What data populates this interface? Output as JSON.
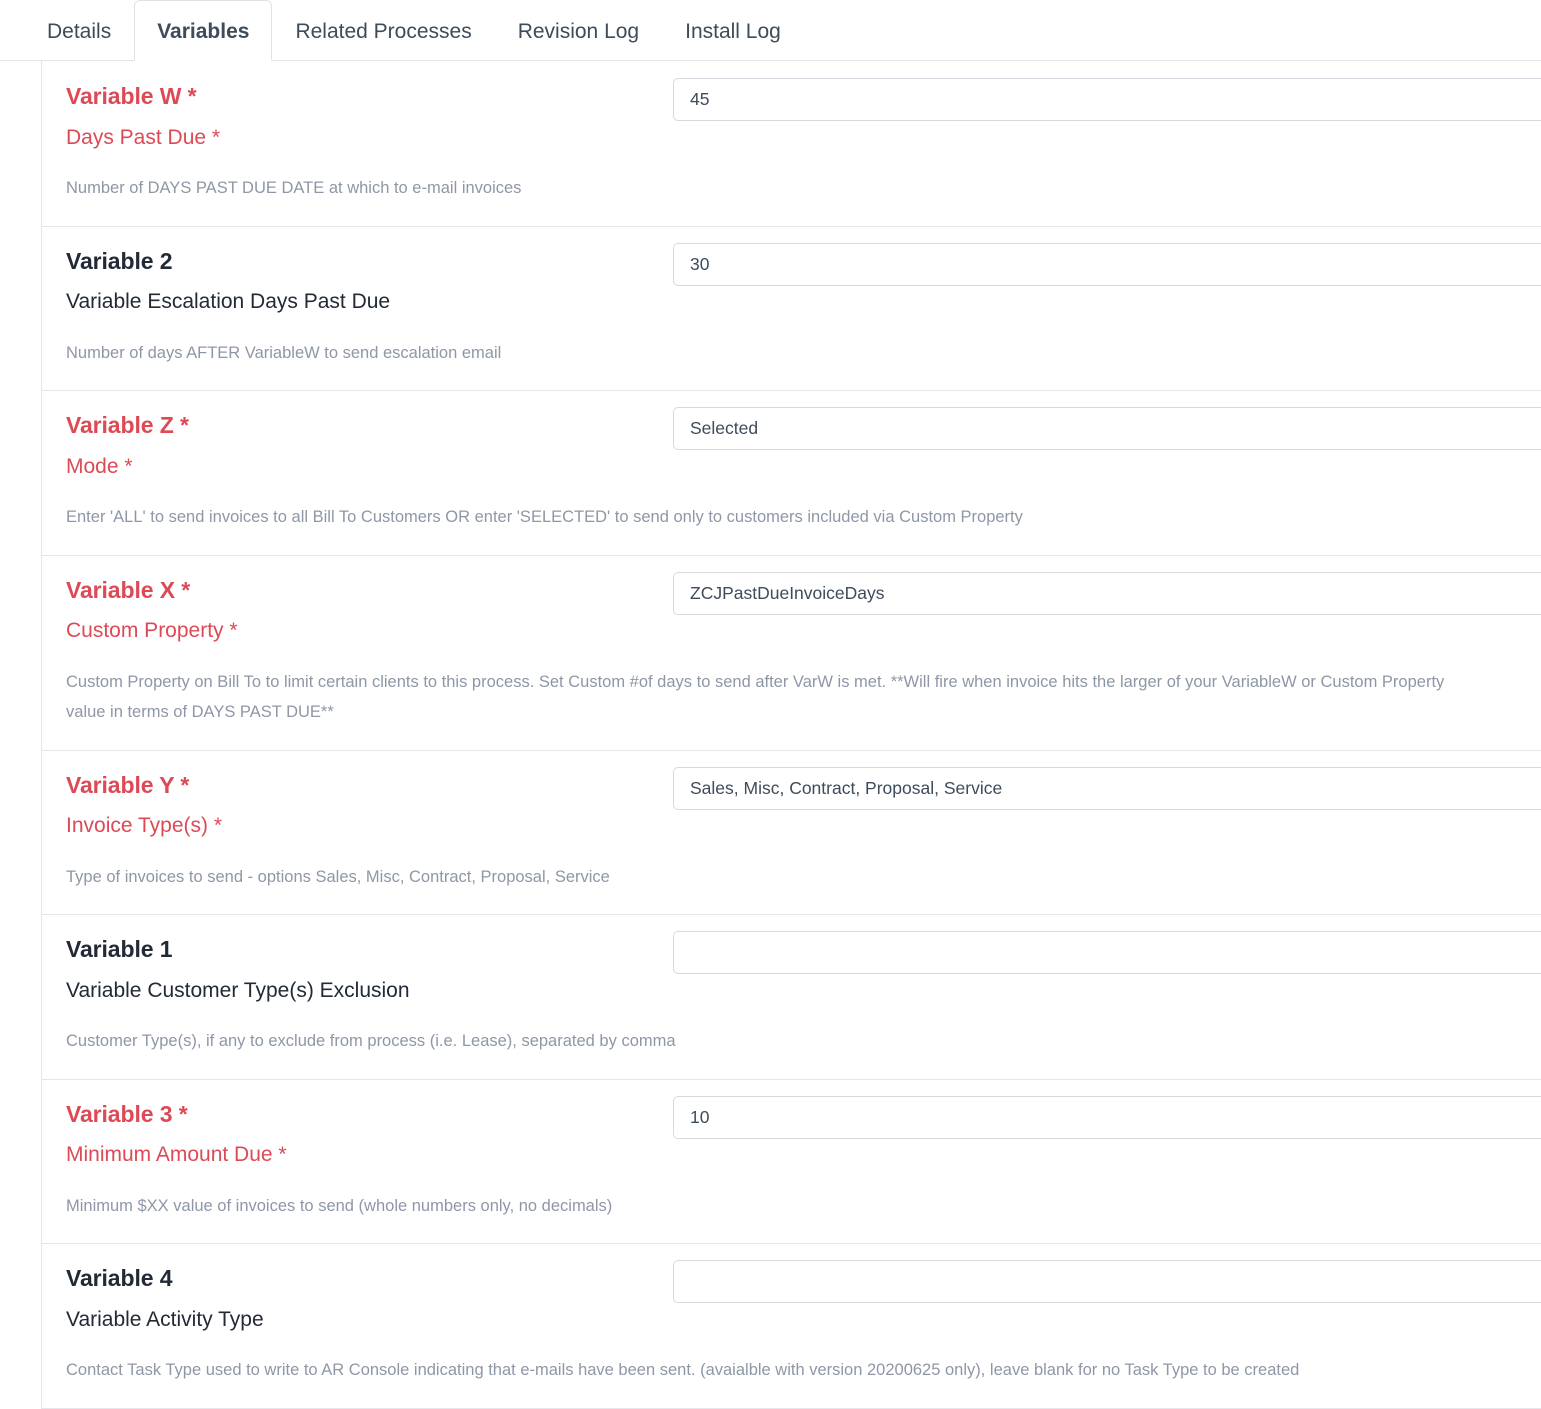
{
  "tabs": [
    {
      "label": "Details",
      "active": false
    },
    {
      "label": "Variables",
      "active": true
    },
    {
      "label": "Related Processes",
      "active": false
    },
    {
      "label": "Revision Log",
      "active": false
    },
    {
      "label": "Install Log",
      "active": false
    }
  ],
  "colors": {
    "required_red": "#dd4a56",
    "text_dark": "#222a35",
    "description_gray": "#8e97a6",
    "border_gray": "#e4e7ea",
    "input_border": "#d5dae0"
  },
  "variables": [
    {
      "title": "Variable W *",
      "subtitle": "Days Past Due *",
      "description": "Number of DAYS PAST DUE DATE at which to e-mail invoices",
      "value": "45",
      "placeholder": "",
      "required": true
    },
    {
      "title": "Variable 2",
      "subtitle": "Variable Escalation Days Past Due",
      "description": "Number of days AFTER VariableW to send escalation email",
      "value": "30",
      "placeholder": "",
      "required": false
    },
    {
      "title": "Variable Z *",
      "subtitle": "Mode *",
      "description": "Enter 'ALL' to send invoices to all Bill To Customers OR enter 'SELECTED' to send only to customers included via Custom Property",
      "value": "Selected",
      "placeholder": "",
      "required": true
    },
    {
      "title": "Variable X *",
      "subtitle": "Custom Property *",
      "description": "Custom Property on Bill To to limit certain clients to this process. Set Custom #of days to send after VarW is met. **Will fire when invoice hits the larger of your VariableW or Custom Property value in terms of DAYS PAST DUE**",
      "value": "ZCJPastDueInvoiceDays",
      "placeholder": "",
      "required": true
    },
    {
      "title": "Variable Y *",
      "subtitle": "Invoice Type(s) *",
      "description": "Type of invoices to send - options Sales, Misc, Contract, Proposal, Service",
      "value": "Sales, Misc, Contract, Proposal, Service",
      "placeholder": "",
      "required": true
    },
    {
      "title": "Variable 1",
      "subtitle": "Variable Customer Type(s) Exclusion",
      "description": "Customer Type(s), if any to exclude from process (i.e. Lease), separated by comma",
      "value": "",
      "placeholder": "",
      "required": false
    },
    {
      "title": "Variable 3 *",
      "subtitle": "Minimum Amount Due *",
      "description": "Minimum $XX value of invoices to send (whole numbers only, no decimals)",
      "value": "10",
      "placeholder": "",
      "required": true
    },
    {
      "title": "Variable 4",
      "subtitle": "Variable Activity Type",
      "description": "Contact Task Type used to write to AR Console indicating that e-mails have been sent. (avaialble with version 20200625 only), leave blank for no Task Type to be created",
      "value": "",
      "placeholder": "",
      "required": false
    }
  ]
}
